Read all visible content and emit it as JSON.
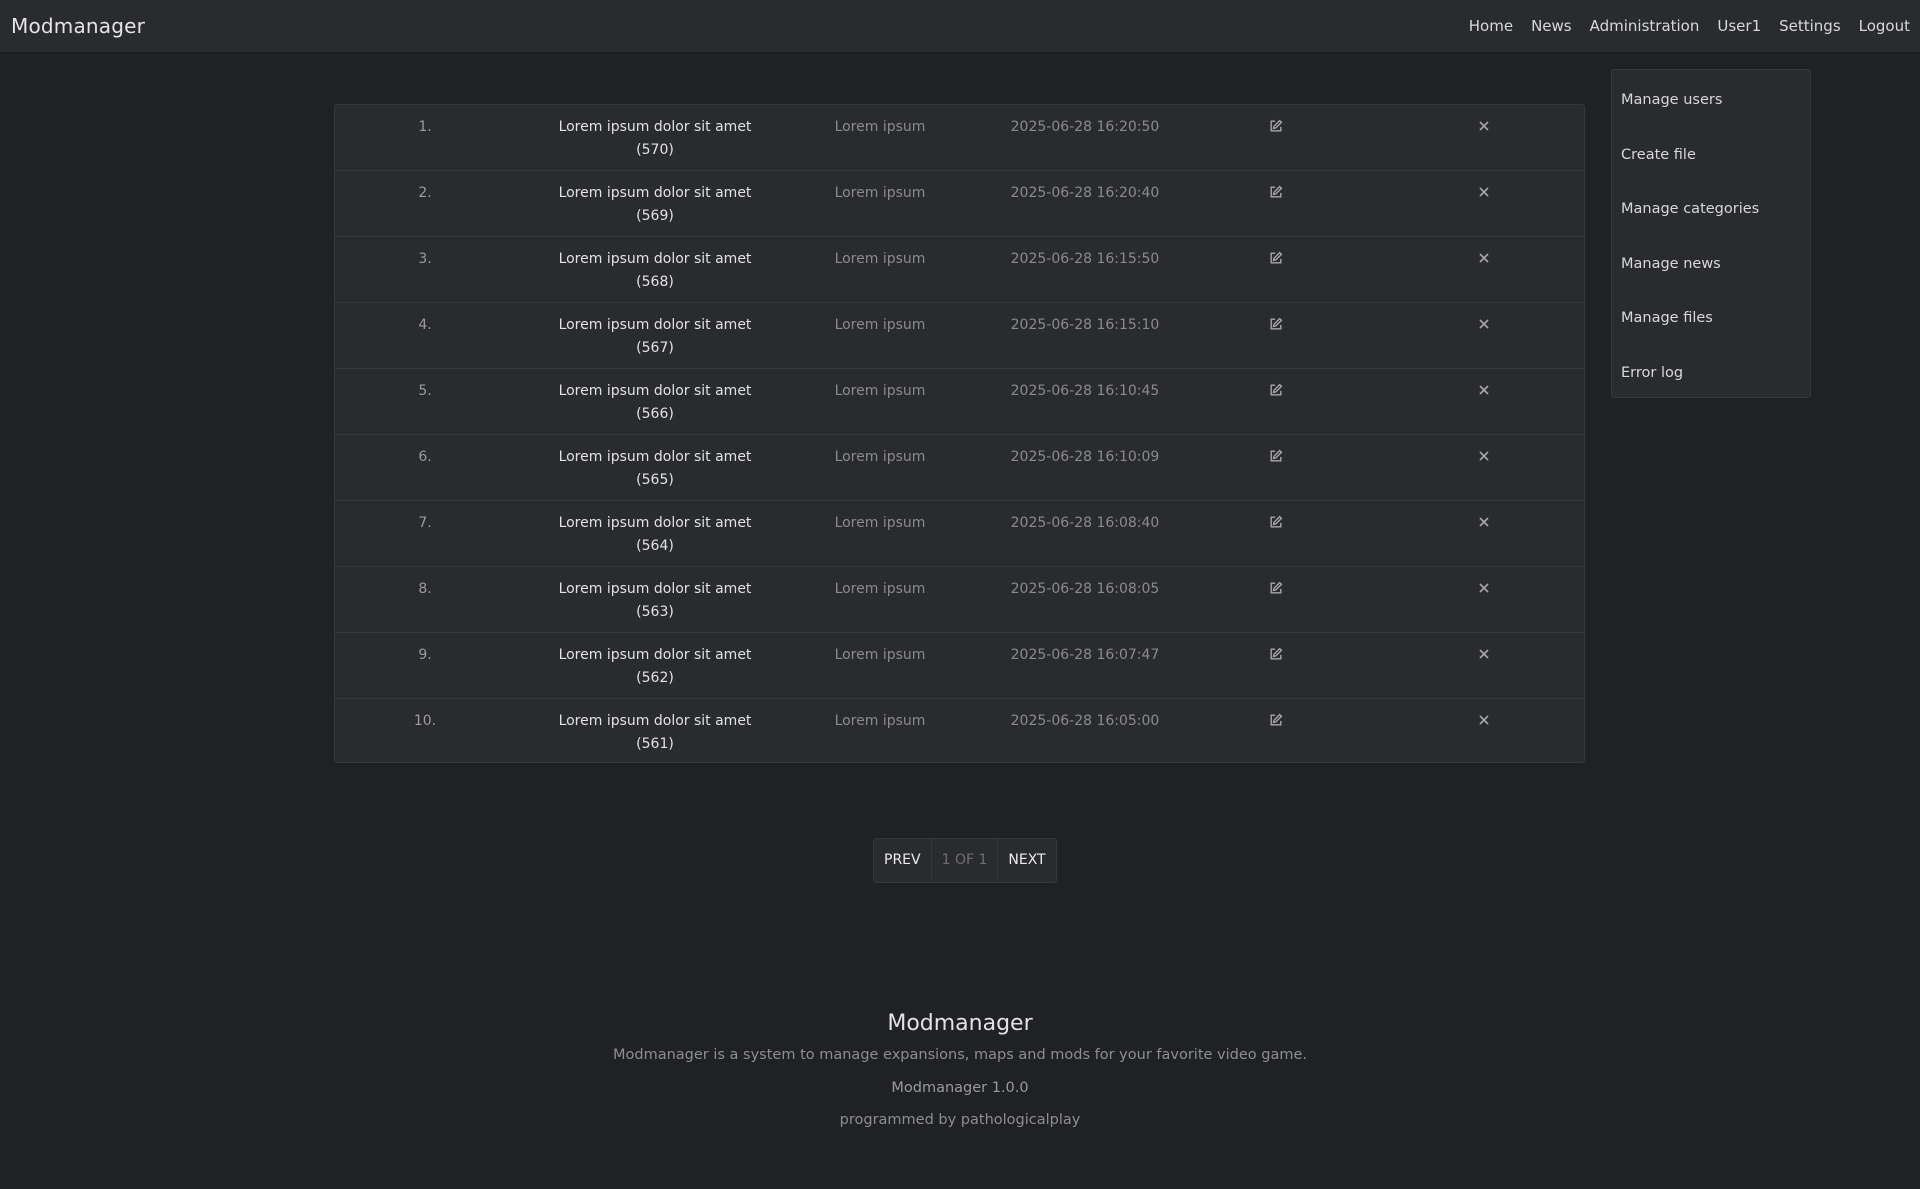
{
  "brand": "Modmanager",
  "nav": [
    "Home",
    "News",
    "Administration",
    "User1",
    "Settings",
    "Logout"
  ],
  "table": {
    "rows": [
      {
        "num": "1.",
        "title": "Lorem ipsum dolor sit amet",
        "id": "(570)",
        "category": "Lorem ipsum",
        "date": "2025-06-28 16:20:50"
      },
      {
        "num": "2.",
        "title": "Lorem ipsum dolor sit amet",
        "id": "(569)",
        "category": "Lorem ipsum",
        "date": "2025-06-28 16:20:40"
      },
      {
        "num": "3.",
        "title": "Lorem ipsum dolor sit amet",
        "id": "(568)",
        "category": "Lorem ipsum",
        "date": "2025-06-28 16:15:50"
      },
      {
        "num": "4.",
        "title": "Lorem ipsum dolor sit amet",
        "id": "(567)",
        "category": "Lorem ipsum",
        "date": "2025-06-28 16:15:10"
      },
      {
        "num": "5.",
        "title": "Lorem ipsum dolor sit amet",
        "id": "(566)",
        "category": "Lorem ipsum",
        "date": "2025-06-28 16:10:45"
      },
      {
        "num": "6.",
        "title": "Lorem ipsum dolor sit amet",
        "id": "(565)",
        "category": "Lorem ipsum",
        "date": "2025-06-28 16:10:09"
      },
      {
        "num": "7.",
        "title": "Lorem ipsum dolor sit amet",
        "id": "(564)",
        "category": "Lorem ipsum",
        "date": "2025-06-28 16:08:40"
      },
      {
        "num": "8.",
        "title": "Lorem ipsum dolor sit amet",
        "id": "(563)",
        "category": "Lorem ipsum",
        "date": "2025-06-28 16:08:05"
      },
      {
        "num": "9.",
        "title": "Lorem ipsum dolor sit amet",
        "id": "(562)",
        "category": "Lorem ipsum",
        "date": "2025-06-28 16:07:47"
      },
      {
        "num": "10.",
        "title": "Lorem ipsum dolor sit amet",
        "id": "(561)",
        "category": "Lorem ipsum",
        "date": "2025-06-28 16:05:00"
      }
    ],
    "edit_icon": "edit-icon",
    "delete_icon": "close-icon"
  },
  "sidebar": {
    "items": [
      "Manage users",
      "Create file",
      "Manage categories",
      "Manage news",
      "Manage files",
      "Error log"
    ]
  },
  "pagination": {
    "prev": "PREV",
    "info": "1 OF 1",
    "next": "NEXT"
  },
  "footer": {
    "title": "Modmanager",
    "description": "Modmanager is a system to manage expansions, maps and mods for your favorite video game.",
    "version": "Modmanager 1.0.0",
    "credit": "programmed by pathologicalplay"
  },
  "colors": {
    "background": "#202125",
    "panel": "#2a2b2f",
    "border": "#36373b"
  }
}
